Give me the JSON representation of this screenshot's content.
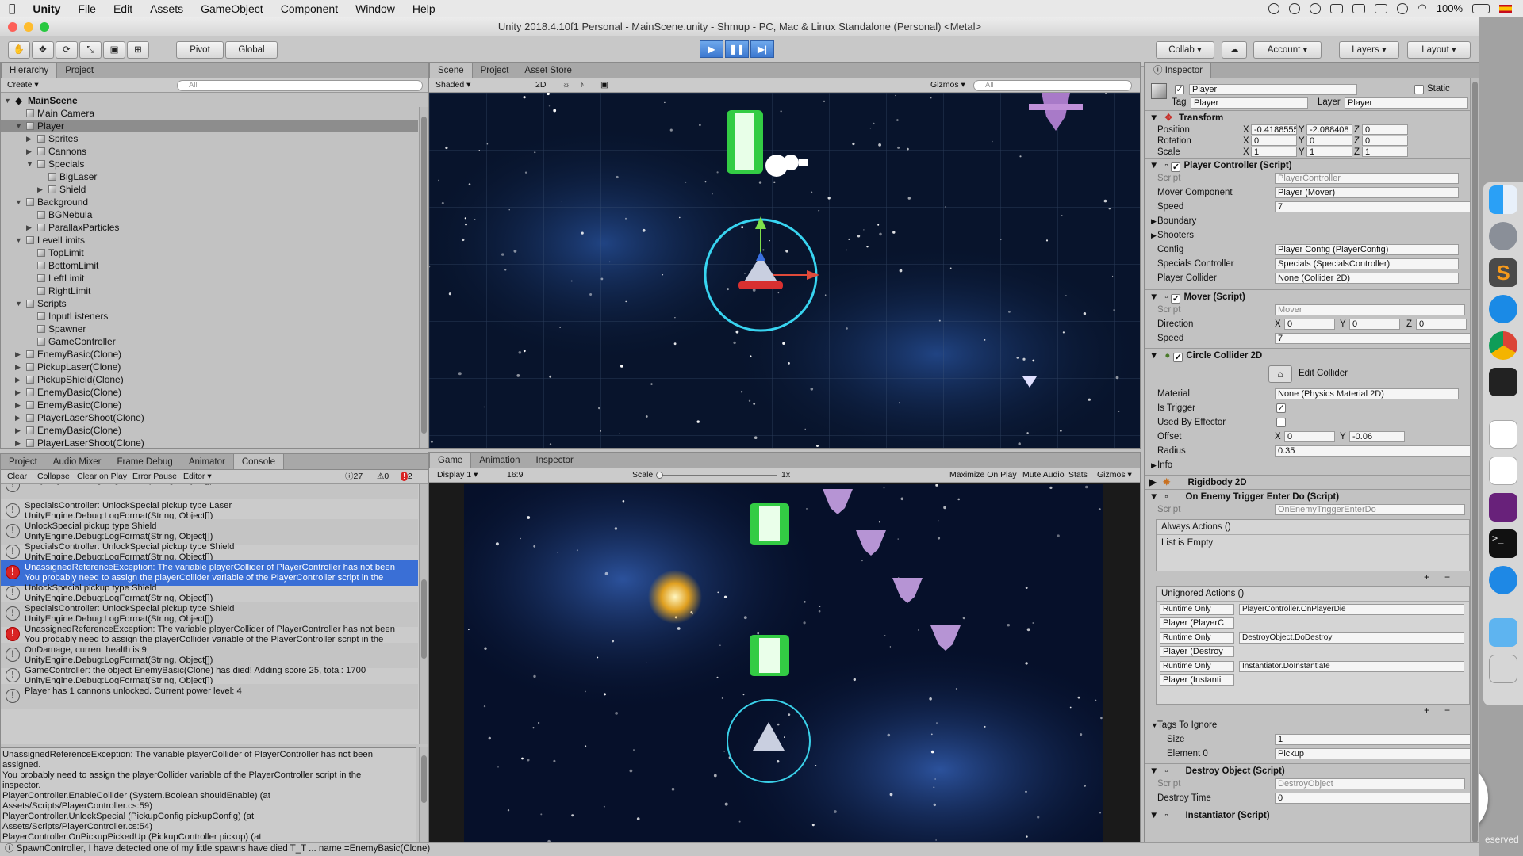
{
  "macbar": {
    "apple": "",
    "app": "Unity",
    "menus": [
      "File",
      "Edit",
      "Assets",
      "GameObject",
      "Component",
      "Window",
      "Help"
    ],
    "battery": "100%"
  },
  "window": {
    "title": "Unity 2018.4.10f1 Personal - MainScene.unity - Shmup - PC, Mac & Linux Standalone (Personal) <Metal>"
  },
  "toolbar": {
    "pivot": "Pivot",
    "global": "Global",
    "collab": "Collab",
    "account": "Account",
    "layers": "Layers",
    "layout": "Layout"
  },
  "hierarchy": {
    "tabs": [
      "Hierarchy",
      "Project"
    ],
    "create": "Create",
    "search_placeholder": "All",
    "scene": "MainScene",
    "items": [
      {
        "label": "Main Camera",
        "indent": 1,
        "arrow": ""
      },
      {
        "label": "Player",
        "indent": 1,
        "arrow": "▼",
        "selected": true
      },
      {
        "label": "Sprites",
        "indent": 2,
        "arrow": "▶"
      },
      {
        "label": "Cannons",
        "indent": 2,
        "arrow": "▶"
      },
      {
        "label": "Specials",
        "indent": 2,
        "arrow": "▼"
      },
      {
        "label": "BigLaser",
        "indent": 3,
        "arrow": ""
      },
      {
        "label": "Shield",
        "indent": 3,
        "arrow": "▶"
      },
      {
        "label": "Background",
        "indent": 1,
        "arrow": "▼"
      },
      {
        "label": "BGNebula",
        "indent": 2,
        "arrow": ""
      },
      {
        "label": "ParallaxParticles",
        "indent": 2,
        "arrow": "▶"
      },
      {
        "label": "LevelLimits",
        "indent": 1,
        "arrow": "▼"
      },
      {
        "label": "TopLimit",
        "indent": 2,
        "arrow": ""
      },
      {
        "label": "BottomLimit",
        "indent": 2,
        "arrow": ""
      },
      {
        "label": "LeftLimit",
        "indent": 2,
        "arrow": ""
      },
      {
        "label": "RightLimit",
        "indent": 2,
        "arrow": ""
      },
      {
        "label": "Scripts",
        "indent": 1,
        "arrow": "▼"
      },
      {
        "label": "InputListeners",
        "indent": 2,
        "arrow": ""
      },
      {
        "label": "Spawner",
        "indent": 2,
        "arrow": ""
      },
      {
        "label": "GameController",
        "indent": 2,
        "arrow": ""
      },
      {
        "label": "EnemyBasic(Clone)",
        "indent": 1,
        "arrow": "▶"
      },
      {
        "label": "PickupLaser(Clone)",
        "indent": 1,
        "arrow": "▶"
      },
      {
        "label": "PickupShield(Clone)",
        "indent": 1,
        "arrow": "▶"
      },
      {
        "label": "EnemyBasic(Clone)",
        "indent": 1,
        "arrow": "▶"
      },
      {
        "label": "EnemyBasic(Clone)",
        "indent": 1,
        "arrow": "▶"
      },
      {
        "label": "PlayerLaserShoot(Clone)",
        "indent": 1,
        "arrow": "▶"
      },
      {
        "label": "EnemyBasic(Clone)",
        "indent": 1,
        "arrow": "▶"
      },
      {
        "label": "PlayerLaserShoot(Clone)",
        "indent": 1,
        "arrow": "▶"
      },
      {
        "label": "PlayerLaserShoot(Clone)",
        "indent": 1,
        "arrow": "▶"
      }
    ]
  },
  "console": {
    "tabs": [
      "Project",
      "Audio Mixer",
      "Frame Debug",
      "Animator",
      "Console"
    ],
    "buttons": [
      "Clear",
      "Collapse",
      "Clear on Play",
      "Error Pause",
      "Editor"
    ],
    "counts": {
      "info": "27",
      "warn": "0",
      "err": "2"
    },
    "entries": [
      {
        "l1": "UnityEngine.Debug:LogFormat(String, Object[])",
        "l2": "",
        "type": "info",
        "partial": true
      },
      {
        "l1": "SpecialsController: UnlockSpecial pickup type Laser",
        "l2": "UnityEngine.Debug:LogFormat(String, Object[])",
        "type": "info"
      },
      {
        "l1": "UnlockSpecial pickup type Shield",
        "l2": "UnityEngine.Debug:LogFormat(String, Object[])",
        "type": "info"
      },
      {
        "l1": "SpecialsController: UnlockSpecial pickup type Shield",
        "l2": "UnityEngine.Debug:LogFormat(String, Object[])",
        "type": "info"
      },
      {
        "l1": "UnassignedReferenceException: The variable playerCollider of PlayerController has not been",
        "l2": "You probably need to assign the playerCollider variable of the PlayerController script in the",
        "type": "err",
        "selected": true
      },
      {
        "l1": "UnlockSpecial pickup type Shield",
        "l2": "UnityEngine.Debug:LogFormat(String, Object[])",
        "type": "info"
      },
      {
        "l1": "SpecialsController: UnlockSpecial pickup type Shield",
        "l2": "UnityEngine.Debug:LogFormat(String, Object[])",
        "type": "info"
      },
      {
        "l1": "UnassignedReferenceException: The variable playerCollider of PlayerController has not been",
        "l2": "You probably need to assign the playerCollider variable of the PlayerController script in the",
        "type": "err"
      },
      {
        "l1": "OnDamage, current health is 9",
        "l2": "UnityEngine.Debug:LogFormat(String, Object[])",
        "type": "info"
      },
      {
        "l1": "GameController: the object EnemyBasic(Clone) has died! Adding score 25, total: 1700",
        "l2": "UnityEngine.Debug:LogFormat(String, Object[])",
        "type": "info"
      },
      {
        "l1": "Player has 1 cannons unlocked. Current power level: 4",
        "l2": "",
        "type": "info"
      }
    ],
    "detail": [
      "UnassignedReferenceException: The variable playerCollider of PlayerController has not been",
      "assigned.",
      "You probably need to assign the playerCollider variable of the PlayerController script in the",
      "inspector.",
      "PlayerController.EnableCollider (System.Boolean shouldEnable) (at",
      "Assets/Scripts/PlayerController.cs:59)",
      "PlayerController.UnlockSpecial (PickupConfig pickupConfig) (at",
      "Assets/Scripts/PlayerController.cs:54)",
      "PlayerController.OnPickupPickedUp (PickupController pickup) (at",
      "Assets/Scripts/GameController.cs:38)"
    ]
  },
  "scene": {
    "tabs": [
      "Scene",
      "Project",
      "Asset Store"
    ],
    "shaded": "Shaded",
    "mode2d": "2D",
    "gizmos": "Gizmos",
    "search_placeholder": "All"
  },
  "game": {
    "tabs": [
      "Game",
      "Animation",
      "Inspector"
    ],
    "display": "Display 1",
    "aspect": "16:9",
    "scale_label": "Scale",
    "scale_value": "1x",
    "buttons": [
      "Maximize On Play",
      "Mute Audio",
      "Stats",
      "Gizmos"
    ]
  },
  "inspector": {
    "tab": "Inspector",
    "object_name": "Player",
    "static": "Static",
    "tag_label": "Tag",
    "tag": "Player",
    "layer_label": "Layer",
    "layer": "Player",
    "transform": {
      "title": "Transform",
      "rows": [
        {
          "label": "Position",
          "x": "-0.4188555",
          "y": "-2.088408",
          "z": "0"
        },
        {
          "label": "Rotation",
          "x": "0",
          "y": "0",
          "z": "0"
        },
        {
          "label": "Scale",
          "x": "1",
          "y": "1",
          "z": "1"
        }
      ]
    },
    "player_controller": {
      "title": "Player Controller (Script)",
      "rows": [
        {
          "label": "Script",
          "value": "PlayerController",
          "disabled": true
        },
        {
          "label": "Mover Component",
          "value": "Player (Mover)"
        },
        {
          "label": "Speed",
          "value": "7"
        },
        {
          "label": "Boundary",
          "value": "",
          "fold": true
        },
        {
          "label": "Shooters",
          "value": "",
          "fold": true
        },
        {
          "label": "Config",
          "value": "Player Config (PlayerConfig)"
        },
        {
          "label": "Specials Controller",
          "value": "Specials (SpecialsController)"
        },
        {
          "label": "Player Collider",
          "value": "None (Collider 2D)"
        }
      ]
    },
    "mover": {
      "title": "Mover (Script)",
      "script": "Mover",
      "direction": {
        "label": "Direction",
        "x": "0",
        "y": "0",
        "z": "0"
      },
      "speed_label": "Speed",
      "speed": "7"
    },
    "collider": {
      "title": "Circle Collider 2D",
      "edit": "Edit Collider",
      "material_label": "Material",
      "material": "None (Physics Material 2D)",
      "trigger_label": "Is Trigger",
      "effector_label": "Used By Effector",
      "offset_label": "Offset",
      "offset_x": "0",
      "offset_y": "-0.06",
      "radius_label": "Radius",
      "radius": "0.35",
      "info": "Info"
    },
    "rigidbody": {
      "title": "Rigidbody 2D"
    },
    "enemy_trigger": {
      "title": "On Enemy Trigger Enter Do (Script)",
      "script": "OnEnemyTriggerEnterDo",
      "always": "Always Actions ()",
      "empty": "List is Empty",
      "unignored": "Unignored Actions ()",
      "actions": [
        {
          "mode": "Runtime Only",
          "fn": "PlayerController.OnPlayerDie",
          "obj": "Player (PlayerC"
        },
        {
          "mode": "Runtime Only",
          "fn": "DestroyObject.DoDestroy",
          "obj": "Player (Destroy"
        },
        {
          "mode": "Runtime Only",
          "fn": "Instantiator.DoInstantiate",
          "obj": "Player (Instanti"
        }
      ]
    },
    "tags_ignore": {
      "title": "Tags To Ignore",
      "size_label": "Size",
      "size": "1",
      "el_label": "Element 0",
      "el": "Pickup"
    },
    "destroy": {
      "title": "Destroy Object (Script)",
      "script": "DestroyObject",
      "time_label": "Destroy Time",
      "time": "0"
    },
    "instantiator": {
      "title": "Instantiator (Script)"
    }
  },
  "statusbar": {
    "text": "SpawnController, I have detected one of my little spawns have died T_T ... name =EnemyBasic(Clone)"
  },
  "watermark": "eserved"
}
